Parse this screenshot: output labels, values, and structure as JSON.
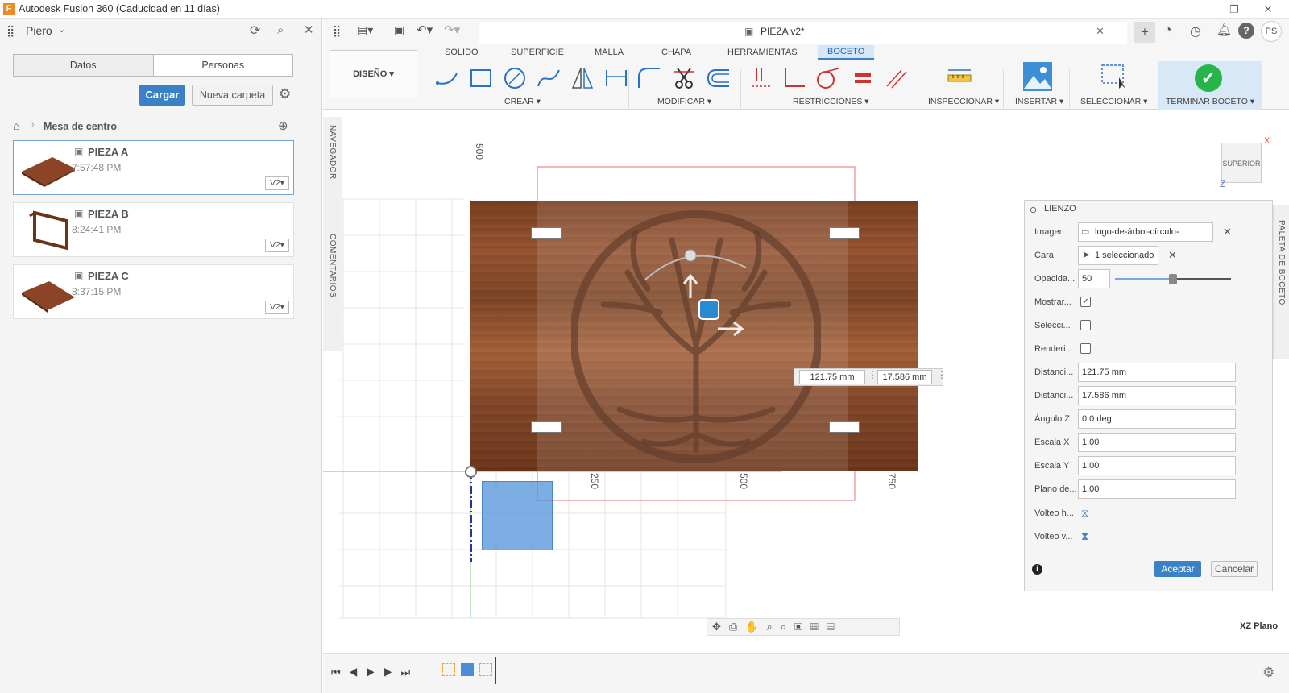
{
  "app": {
    "title": "Autodesk Fusion 360 (Caducidad en 11 días)",
    "logo": "F"
  },
  "left": {
    "user": "Piero",
    "tabs": [
      "Datos",
      "Personas"
    ],
    "upload": "Cargar",
    "new_folder": "Nueva carpeta",
    "breadcrumb": "Mesa de centro",
    "files": [
      {
        "name": "PIEZA A",
        "time": "7:57:48 PM",
        "version": "V2▾"
      },
      {
        "name": "PIEZA B",
        "time": "8:24:41 PM",
        "version": "V2▾"
      },
      {
        "name": "PIEZA C",
        "time": "8:37:15 PM",
        "version": "V2▾"
      }
    ]
  },
  "toolbar": {
    "doc_title": "PIEZA v2*",
    "workspace": "DISEÑO ▾",
    "tabs": [
      "SOLIDO",
      "SUPERFICIE",
      "MALLA",
      "CHAPA",
      "HERRAMIENTAS",
      "BOCETO"
    ],
    "active_tab": "BOCETO",
    "groups": [
      "CREAR ▾",
      "MODIFICAR ▾",
      "RESTRICCIONES ▾",
      "INSPECCIONAR ▾",
      "INSERTAR ▾",
      "SELECCIONAR ▾",
      "TERMINAR BOCETO ▾"
    ],
    "avatar": "PS"
  },
  "viewport": {
    "navigator": "NAVEGADOR",
    "comments": "COMENTARIOS",
    "palette": "PALETA DE BOCETO",
    "view_cube": "SUPERIOR",
    "axis_x": "X",
    "axis_z": "Z",
    "ruler_v": "500",
    "ruler_h": [
      "250",
      "500",
      "750"
    ],
    "dim1": "121.75 mm",
    "dim2": "17.586 mm",
    "plane": "XZ Plano"
  },
  "canvas": {
    "header": "LIENZO",
    "rows": [
      {
        "label": "Imagen",
        "value": "logo-de-árbol-círculo-redonc..."
      },
      {
        "label": "Cara",
        "value": "1 seleccionado"
      },
      {
        "label": "Opacida...",
        "value": "50"
      },
      {
        "label": "Mostrar...",
        "value": "✓"
      },
      {
        "label": "Selecci...",
        "value": ""
      },
      {
        "label": "Renderi...",
        "value": ""
      },
      {
        "label": "Distanci...",
        "value": "121.75 mm"
      },
      {
        "label": "Distanci...",
        "value": "17.586 mm"
      },
      {
        "label": "Ángulo Z",
        "value": "0.0 deg"
      },
      {
        "label": "Escala X",
        "value": "1.00"
      },
      {
        "label": "Escala Y",
        "value": "1.00"
      },
      {
        "label": "Plano de...",
        "value": "1.00"
      },
      {
        "label": "Volteo h...",
        "value": ""
      },
      {
        "label": "Volteo v...",
        "value": ""
      }
    ],
    "opacity_fraction": 0.5,
    "accept": "Aceptar",
    "cancel": "Cancelar"
  },
  "colors": {
    "accent": "#3a81c5",
    "active_tab": "#d6e6f8",
    "finish": "#27b44a"
  }
}
